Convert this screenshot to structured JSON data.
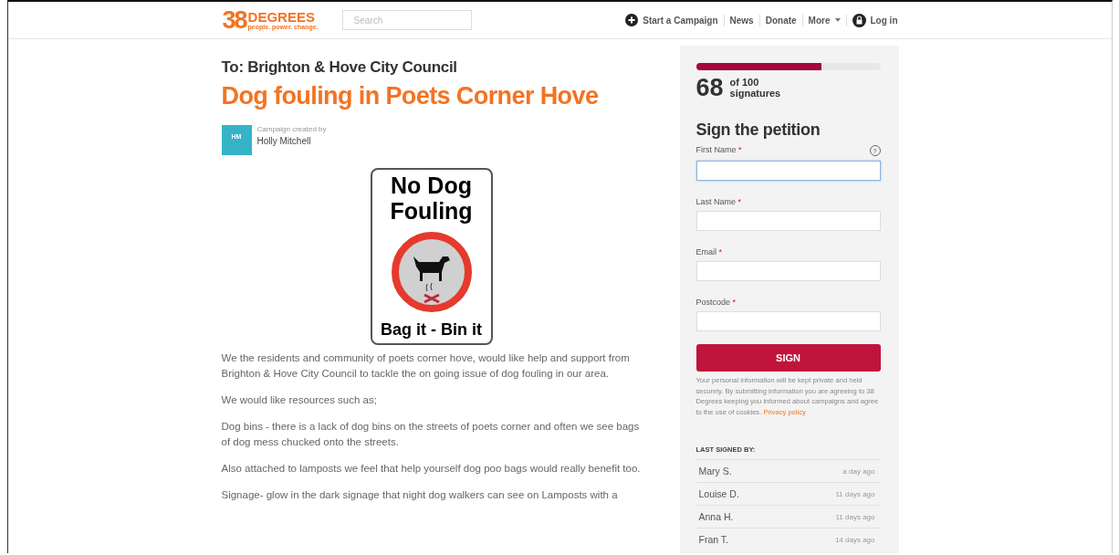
{
  "header": {
    "logo": {
      "number": "38",
      "name": "DEGREES",
      "tagline": "people. power. change."
    },
    "search": {
      "placeholder": "Search"
    },
    "nav": [
      {
        "label": "Start a Campaign",
        "kind": "plus"
      },
      {
        "label": "News",
        "kind": "plain"
      },
      {
        "label": "Donate",
        "kind": "plain"
      },
      {
        "label": "More",
        "kind": "dropdown"
      },
      {
        "label": "Log in",
        "kind": "lock"
      }
    ]
  },
  "petition": {
    "recipient": "To: Brighton & Hove City Council",
    "title": "Dog fouling in Poets Corner Hove",
    "creator_label": "Campaign created by",
    "creator_initials": "HM",
    "creator_name": "Holly Mitchell",
    "sign_image": {
      "heading": "No Dog Fouling",
      "footer": "Bag it - Bin it"
    },
    "paragraphs": [
      "We the residents and community of poets corner hove, would like help and support from Brighton & Hove City Council to tackle the on going issue of dog fouling in our area.",
      "We would like resources such as;",
      "Dog bins - there is a lack of dog bins on the streets of poets corner and often we see bags of dog mess chucked onto the streets.",
      "Also attached to lamposts we feel that help yourself dog poo bags would really benefit too.",
      "Signage- glow in the dark signage that night dog walkers can see on Lamposts with a"
    ]
  },
  "sidebar": {
    "progress": {
      "level": 0.68
    },
    "count": "68",
    "goal": "of 100",
    "goal_unit": "signatures",
    "form_title": "Sign the petition",
    "fields": [
      {
        "label": "First Name",
        "required": "*",
        "focused": true,
        "help": "?"
      },
      {
        "label": "Last Name",
        "required": "*",
        "focused": false
      },
      {
        "label": "Email",
        "required": "*",
        "focused": false
      },
      {
        "label": "Postcode",
        "required": "*",
        "focused": false
      }
    ],
    "submit": "SIGN",
    "disclaimer": "Your personal information will be kept private and held securely. By submitting information you are agreeing to 38 Degrees keeping you informed about campaigns and agree to the use of cookies.",
    "privacy_link": "Privacy policy",
    "last_signed_title": "LAST SIGNED BY:",
    "signers": [
      {
        "name": "Mary S.",
        "time": "a day ago"
      },
      {
        "name": "Louise D.",
        "time": "11 days ago"
      },
      {
        "name": "Anna H.",
        "time": "11 days ago"
      },
      {
        "name": "Fran T.",
        "time": "14 days ago"
      }
    ]
  }
}
